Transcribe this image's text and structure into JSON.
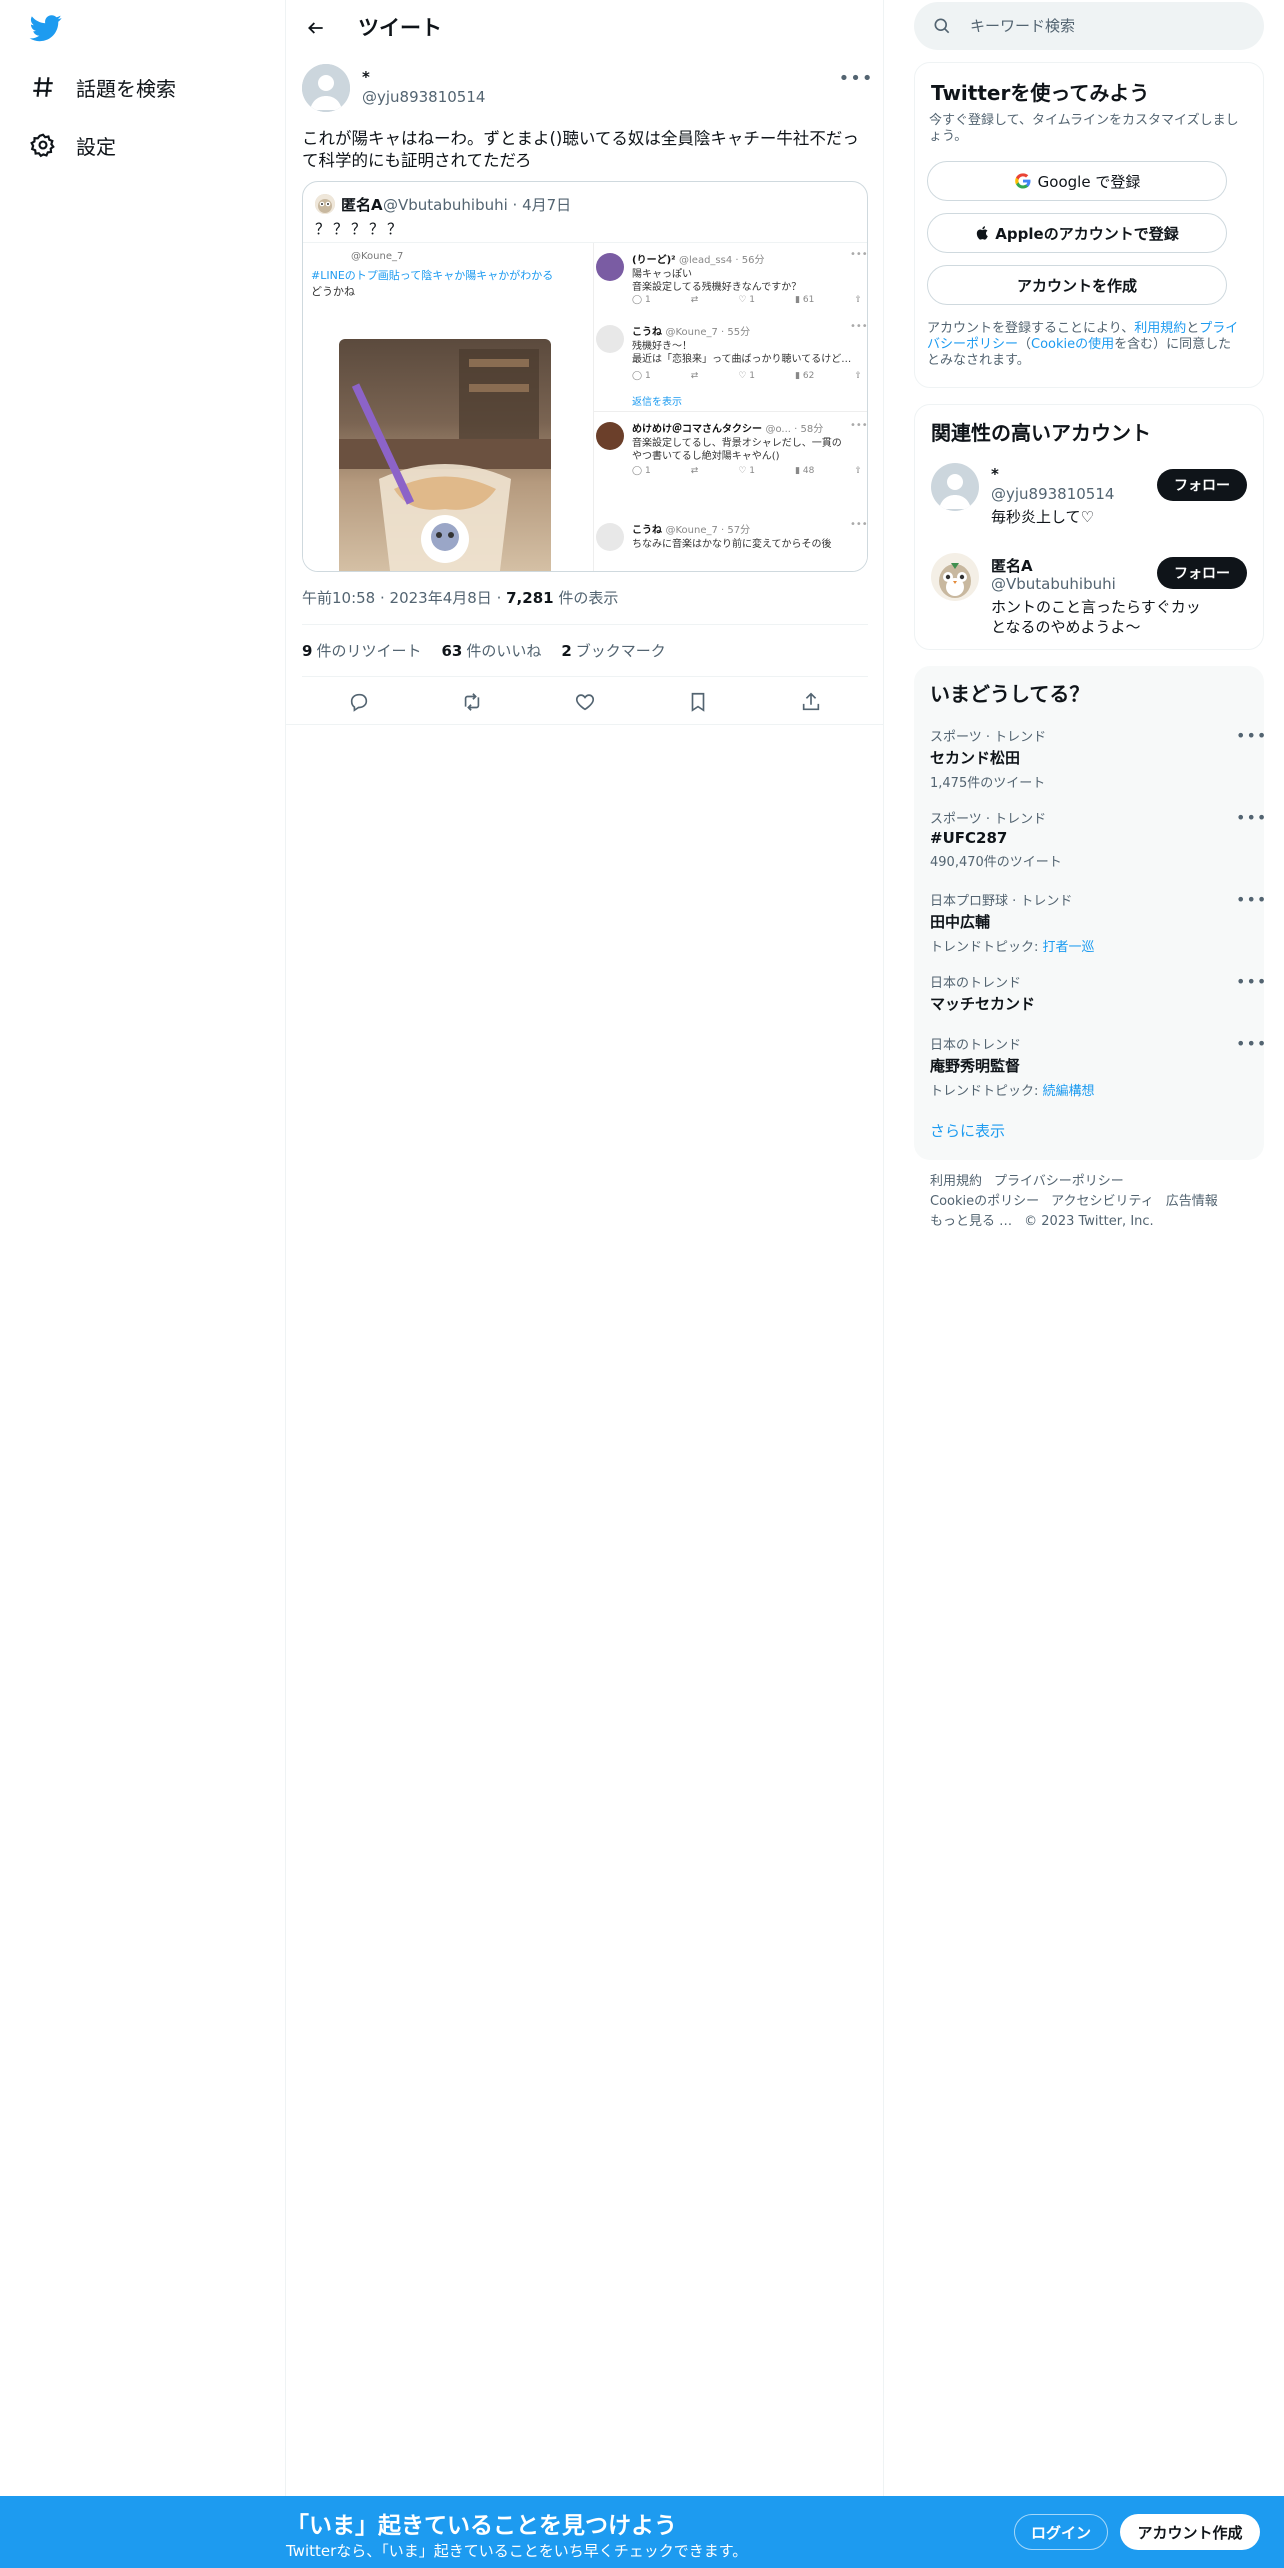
{
  "nav": {
    "explore": "話題を検索",
    "settings": "設定"
  },
  "header": {
    "title": "ツイート"
  },
  "tweet": {
    "author_name": "*",
    "author_handle": "@yju893810514",
    "text": "これが陽キャはねーわ。ずとまよ()聴いてる奴は全員陰キャチー牛社不だって科学的にも証明されてただろ",
    "time": "午前10:58",
    "date": "2023年4月8日",
    "views_count": "7,281",
    "views_label": "件の表示",
    "retweets_count": "9",
    "retweets_label": "件のリツイート",
    "likes_count": "63",
    "likes_label": "件のいいね",
    "bookmarks_count": "2",
    "bookmarks_label": "ブックマーク"
  },
  "quote": {
    "author_name": "匿名A",
    "author_handle": "@Vbutabuhibuhi · 4月7日",
    "text": "？？？？？",
    "media": {
      "left_handle": "@Koune_7",
      "hashtag": "#LINEのトプ画貼って陰キャか陽キャかがわかる",
      "left_text": "どうかね",
      "replies": [
        {
          "name": "(りーど)²",
          "handle": "@lead_ss4 · 56分",
          "line1": "陽キャっぽい",
          "line2": "音楽設定してる残機好きなんですか？",
          "stats": [
            "1",
            "",
            "1",
            "61",
            ""
          ]
        },
        {
          "name": "こうね",
          "handle": "@Koune_7 · 55分",
          "line1": "残機好き〜！",
          "line2": "最近は「恋狼来」って曲ばっかり聴いてるけど…",
          "stats": [
            "1",
            "",
            "1",
            "62",
            ""
          ]
        },
        {
          "name": "めけめけ＠コマさんタクシー",
          "handle": "@o... · 58分",
          "line1": "音楽設定してるし、背景オシャレだし、一貫の",
          "line2": "やつ書いてるし絶対陽キャやん()",
          "stats": [
            "1",
            "",
            "1",
            "48",
            ""
          ]
        },
        {
          "name": "こうね",
          "handle": "@Koune_7 · 57分",
          "line1": "ちなみに音楽はかなり前に変えてからその後",
          "line2": "",
          "stats": []
        }
      ],
      "show_replies": "返信を表示"
    }
  },
  "search": {
    "placeholder": "キーワード検索"
  },
  "signup": {
    "title": "Twitterを使ってみよう",
    "subtitle": "今すぐ登録して、タイムラインをカスタマイズしましょう。",
    "google": "Google で登録",
    "apple": "Appleのアカウントで登録",
    "create": "アカウントを作成",
    "legal_pre": "アカウントを登録することにより、",
    "terms": "利用規約",
    "and": "と",
    "privacy": "プライバシーポリシー",
    "cookie_pre": "（",
    "cookie": "Cookieの使用",
    "legal_post": "を含む）に同意したとみなされます。"
  },
  "related": {
    "title": "関連性の高いアカウント",
    "accounts": [
      {
        "name": "*",
        "handle": "@yju893810514",
        "bio": "毎秒炎上して♡",
        "follow": "フォロー"
      },
      {
        "name": "匿名A",
        "handle": "@Vbutabuhibuhi",
        "bio": "ホントのこと言ったらすぐカッとなるのやめようよ〜",
        "follow": "フォロー"
      }
    ]
  },
  "trends": {
    "title": "いまどうしてる？",
    "items": [
      {
        "category": "スポーツ · トレンド",
        "name": "セカンド松田",
        "count": "1,475件のツイート"
      },
      {
        "category": "スポーツ · トレンド",
        "name": "#UFC287",
        "count": "490,470件のツイート"
      },
      {
        "category": "日本プロ野球 · トレンド",
        "name": "田中広輔",
        "count_prefix": "トレンドトピック: ",
        "count_link": "打者一巡"
      },
      {
        "category": "日本のトレンド",
        "name": "マッチセカンド"
      },
      {
        "category": "日本のトレンド",
        "name": "庵野秀明監督",
        "count_prefix": "トレンドトピック: ",
        "count_link": "続編構想"
      }
    ],
    "show_more": "さらに表示"
  },
  "footer": {
    "terms": "利用規約",
    "privacy": "プライバシーポリシー",
    "cookie": "Cookieのポリシー",
    "accessibility": "アクセシビリティ",
    "ads": "広告情報",
    "more": "もっと見る …",
    "copyright": "© 2023 Twitter, Inc."
  },
  "bottom_bar": {
    "title": "「いま」起きていることを見つけよう",
    "subtitle": "Twitterなら、「いま」起きていることをいち早くチェックできます。",
    "login": "ログイン",
    "signup": "アカウント作成"
  },
  "colors": {
    "accent": "#1d9bf0",
    "text": "#0f1419",
    "muted": "#536471"
  }
}
